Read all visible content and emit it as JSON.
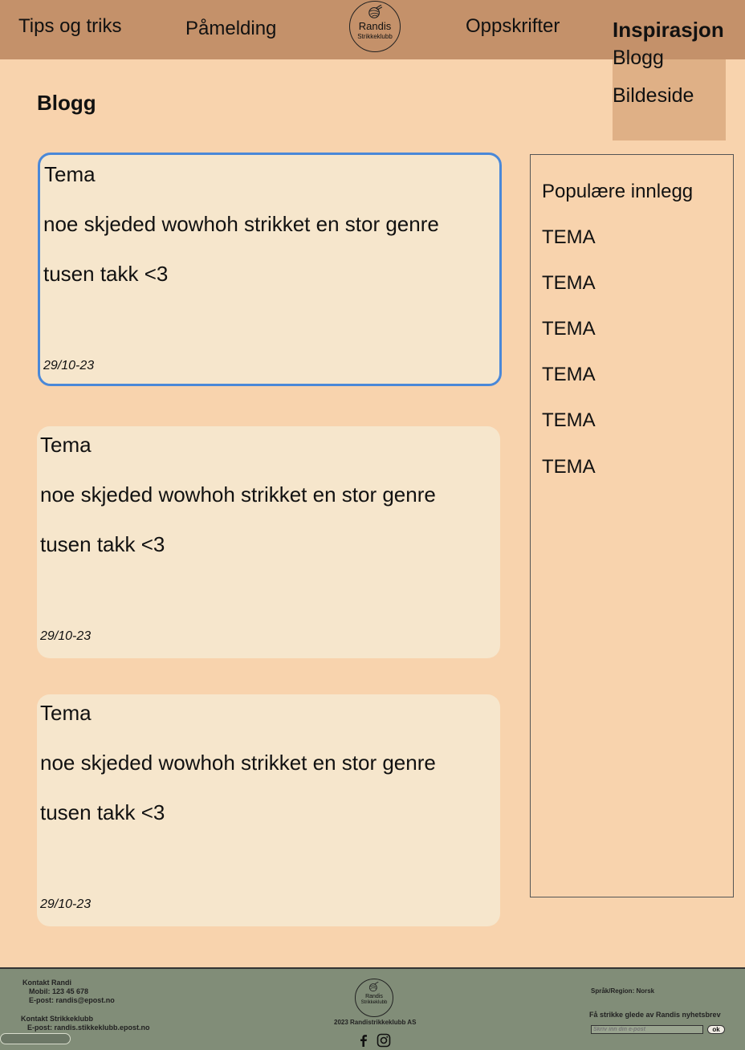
{
  "nav": {
    "tips": "Tips og triks",
    "signup": "Påmelding",
    "recipes": "Oppskrifter",
    "inspiration": "Inspirasjon",
    "dropdown": [
      "Blogg",
      "Bildeside"
    ]
  },
  "logo": {
    "line1": "Randis",
    "line2": "Strikkeklubb"
  },
  "page_title": "Blogg",
  "posts": [
    {
      "theme": "Tema",
      "body": "noe skjeded wowhoh strikket en stor genre",
      "thanks": "tusen takk <3",
      "date": "29/10-23"
    },
    {
      "theme": "Tema",
      "body": "noe skjeded wowhoh strikket en stor genre",
      "thanks": "tusen takk <3",
      "date": "29/10-23"
    },
    {
      "theme": "Tema",
      "body": "noe skjeded wowhoh strikket en stor genre",
      "thanks": "tusen takk <3",
      "date": "29/10-23"
    }
  ],
  "sidebar": {
    "title": "Populære innlegg",
    "items": [
      "TEMA",
      "TEMA",
      "TEMA",
      "TEMA",
      "TEMA",
      "TEMA"
    ]
  },
  "footer": {
    "contact_randi_title": "Kontakt Randi",
    "contact_randi_phone": "Mobil: 123 45 678",
    "contact_randi_email": "E-post: randis@epost.no",
    "contact_club_title": "Kontakt Strikkeklubb",
    "contact_club_email": "E-post: randis.stikkeklubb.epost.no",
    "copyright": "2023 Randistrikkeklubb AS",
    "language": "Språk/Region: Norsk",
    "newsletter": "Få strikke glede av Randis nyhetsbrev",
    "newsletter_placeholder": "Skriv inn din e-post",
    "ok_label": "ok",
    "logo_line1": "Randis",
    "logo_line2": "Strikkeklubb",
    "social": [
      "facebook-icon",
      "instagram-icon"
    ]
  },
  "colors": {
    "header": "#c4916a",
    "page": "#f8d3ad",
    "card": "#f6e6cc",
    "selected_border": "#4a88d8",
    "footer": "#818d78",
    "dropdown": "#dfb086"
  }
}
